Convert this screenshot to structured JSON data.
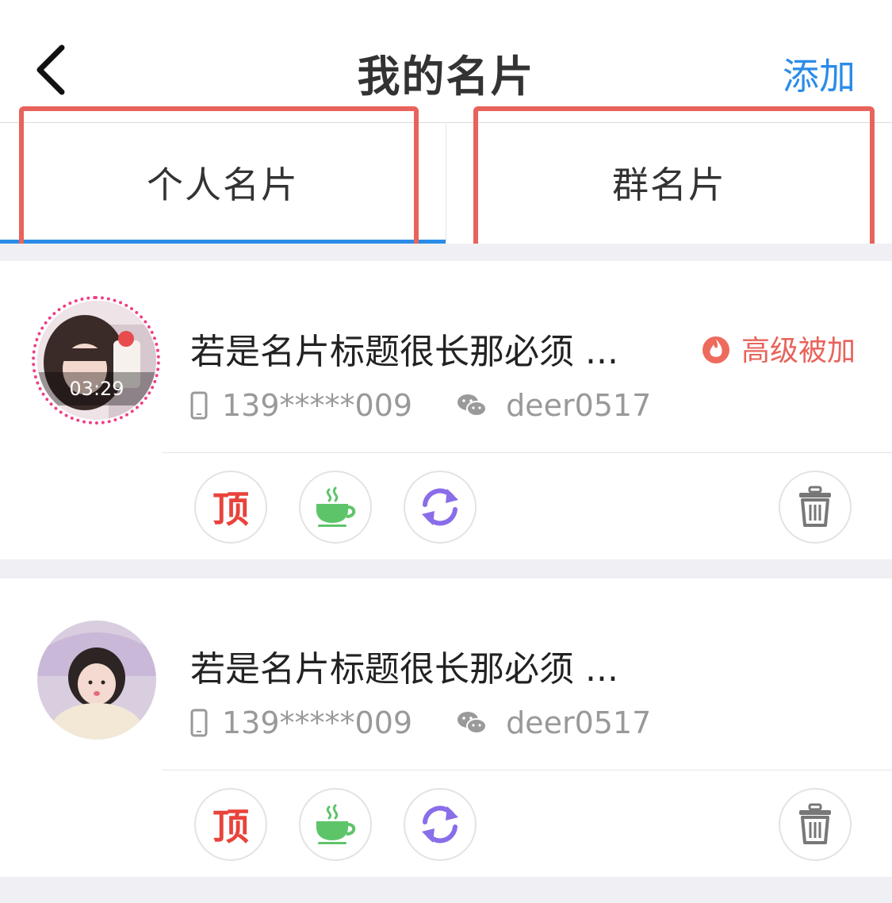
{
  "navbar": {
    "title": "我的名片",
    "add_label": "添加"
  },
  "tabs": [
    {
      "label": "个人名片",
      "active": true
    },
    {
      "label": "群名片",
      "active": false
    }
  ],
  "colors": {
    "accent": "#2b8ce8",
    "highlight": "#e8635b",
    "top_red": "#e8433b",
    "coffee_green": "#5ec46a",
    "refresh_purple": "#8a6de9"
  },
  "cards": [
    {
      "title": "若是名片标题很长那必须 ...",
      "badge": "高级被加",
      "avatar_time": "03:29",
      "phone": "139*****009",
      "wechat": "deer0517",
      "actions": {
        "top_label": "顶"
      }
    },
    {
      "title": "若是名片标题很长那必须 ...",
      "phone": "139*****009",
      "wechat": "deer0517",
      "actions": {
        "top_label": "顶"
      }
    }
  ]
}
